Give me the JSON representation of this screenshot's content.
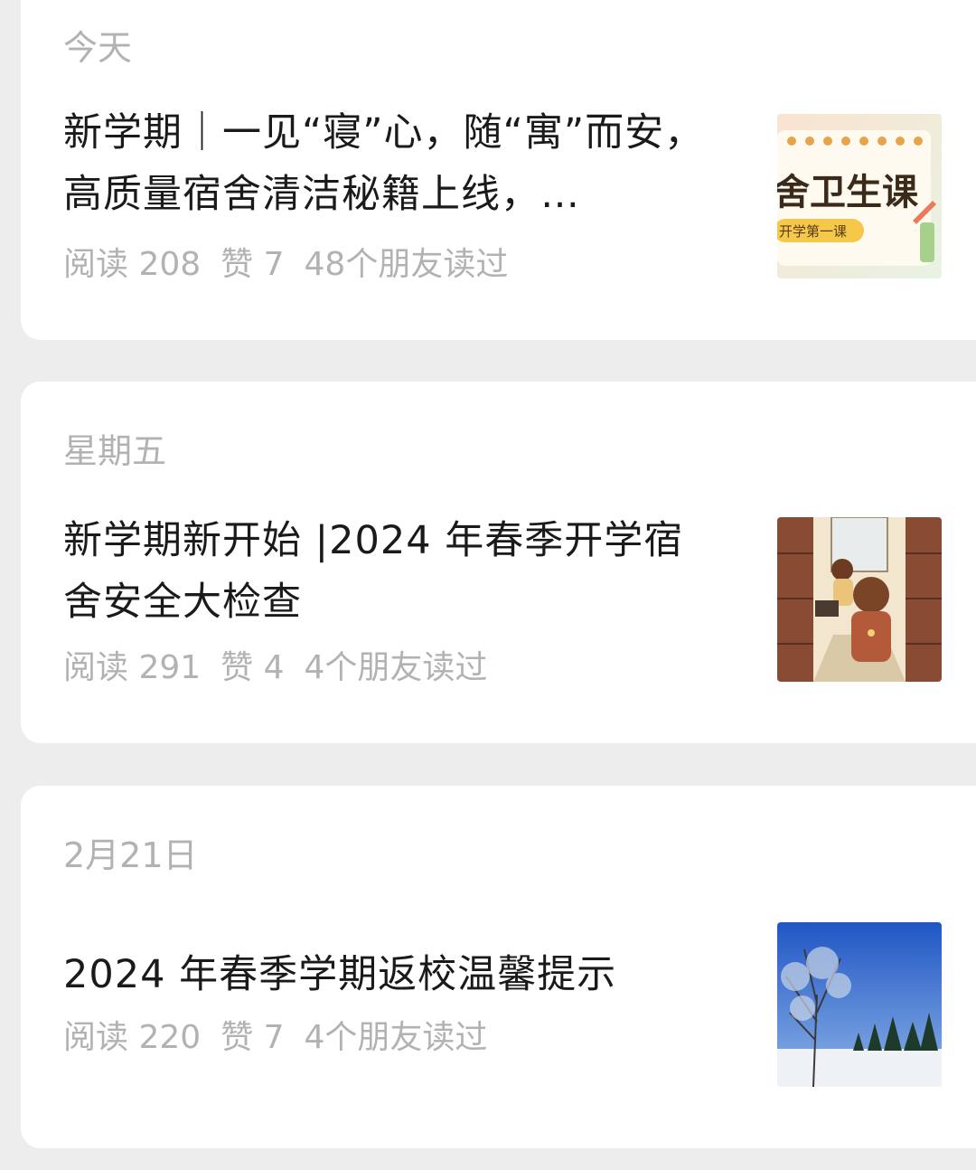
{
  "articles": [
    {
      "date": "今天",
      "title": "新学期｜一见“寝”心，随“寓”而安，高质量宿舍清洁秘籍上线，…",
      "reads": "阅读 208",
      "likes": "赞 7",
      "friends": "48个朋友读过",
      "thumb": {
        "headline": "舍卫生课",
        "tag": "开学第一课"
      }
    },
    {
      "date": "星期五",
      "title": "新学期新开始 |2024 年春季开学宿舍安全大检查",
      "reads": "阅读 291",
      "likes": "赞 4",
      "friends": "4个朋友读过"
    },
    {
      "date": "2月21日",
      "title": "2024 年春季学期返校温馨提示",
      "reads": "阅读 220",
      "likes": "赞 7",
      "friends": "4个朋友读过"
    }
  ]
}
